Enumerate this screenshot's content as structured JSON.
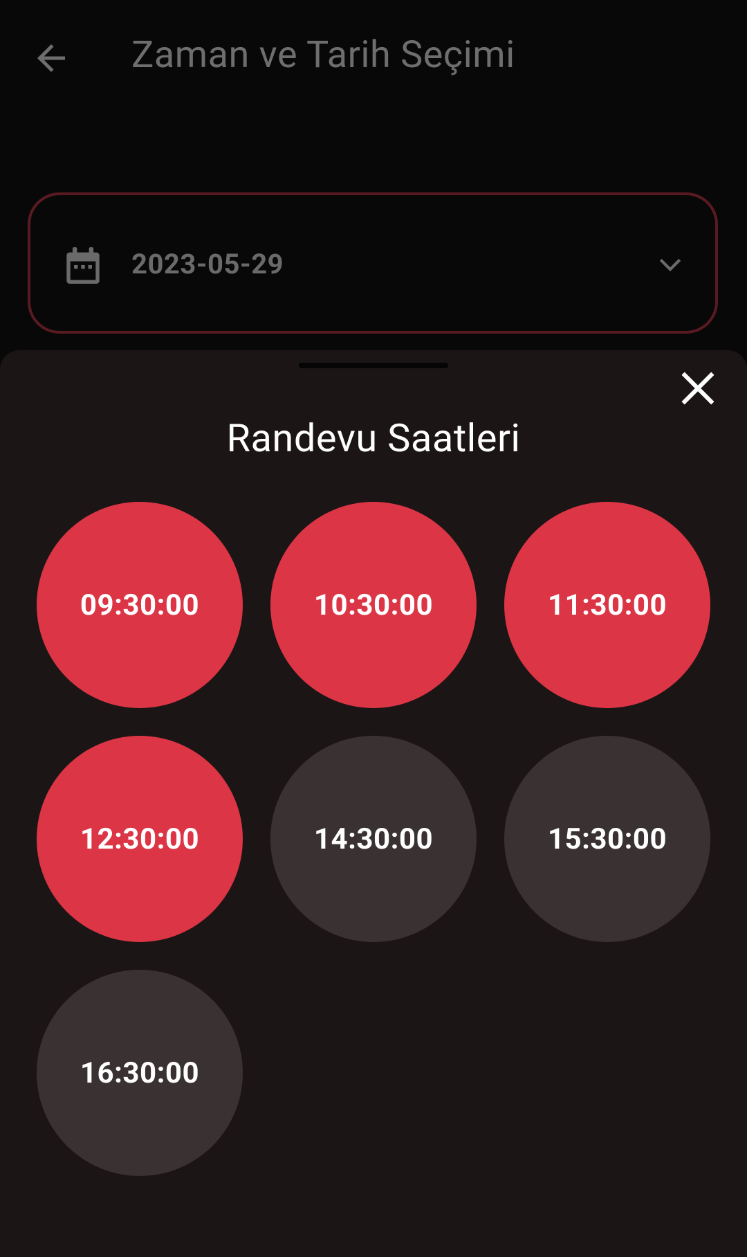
{
  "app_bar": {
    "title": "Zaman ve Tarih Seçimi",
    "back_icon": "arrow-left-icon"
  },
  "date_field": {
    "value": "2023-05-29",
    "leading_icon": "calendar-icon",
    "trailing_icon": "chevron-down-icon"
  },
  "sheet": {
    "title": "Randevu Saatleri",
    "close_icon": "close-icon",
    "slots": [
      {
        "time": "09:30:00",
        "state": "busy"
      },
      {
        "time": "10:30:00",
        "state": "busy"
      },
      {
        "time": "11:30:00",
        "state": "busy"
      },
      {
        "time": "12:30:00",
        "state": "busy"
      },
      {
        "time": "14:30:00",
        "state": "free"
      },
      {
        "time": "15:30:00",
        "state": "free"
      },
      {
        "time": "16:30:00",
        "state": "free"
      }
    ]
  },
  "colors": {
    "busy": "#dc3545",
    "free": "#3a3132",
    "sheet_bg": "#1c1516",
    "field_border": "#5a1a22"
  }
}
